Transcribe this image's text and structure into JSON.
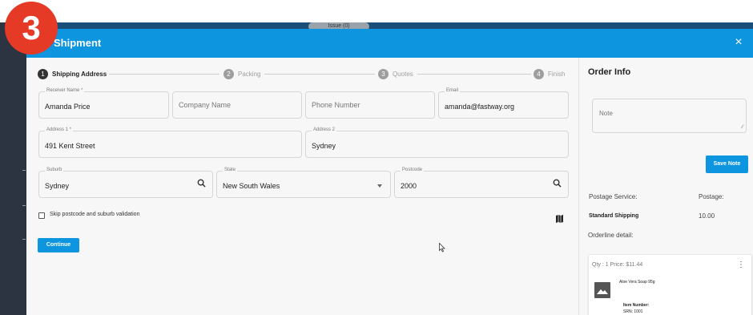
{
  "background": {
    "issue_pill": "Issue (0)"
  },
  "dialog": {
    "badge": "3",
    "title": "Shipment",
    "close_label": "×"
  },
  "stepper": {
    "steps": [
      {
        "num": "1",
        "label": "Shipping Address"
      },
      {
        "num": "2",
        "label": "Packing"
      },
      {
        "num": "3",
        "label": "Quotes"
      },
      {
        "num": "4",
        "label": "Finish"
      }
    ]
  },
  "form": {
    "receiver_name": {
      "label": "Receiver Name *",
      "value": "Amanda Price"
    },
    "company_name": {
      "placeholder": "Company Name"
    },
    "phone_number": {
      "placeholder": "Phone Number"
    },
    "email": {
      "label": "Email",
      "value": "amanda@fastway.org"
    },
    "address1": {
      "label": "Address 1 *",
      "value": "491 Kent Street"
    },
    "address2": {
      "label": "Address 2",
      "value": "Sydney"
    },
    "suburb": {
      "label": "Suburb",
      "value": "Sydney"
    },
    "state": {
      "label": "State",
      "value": "New South Wales"
    },
    "postcode": {
      "label": "Postcode",
      "value": "2000"
    },
    "skip_validation_label": "Skip postcode and suburb validation",
    "continue_label": "Continue"
  },
  "order_info": {
    "title": "Order Info",
    "note_placeholder": "Note",
    "save_note_label": "Save Note",
    "postage_service_label": "Postage Service:",
    "postage_label": "Postage:",
    "service_value": "Standard Shipping",
    "postage_value": "10.00",
    "orderline_label": "Orderline detail:",
    "item": {
      "qty_price": "Qty : 1 Price: $11.44",
      "name": "Aloe Vera Soap 95g",
      "item_number_label": "Item Number:",
      "srn": "SRN:  1001"
    }
  },
  "colors": {
    "accent": "#0d95e0",
    "badge": "#e53a25",
    "dark": "#2b3440"
  }
}
